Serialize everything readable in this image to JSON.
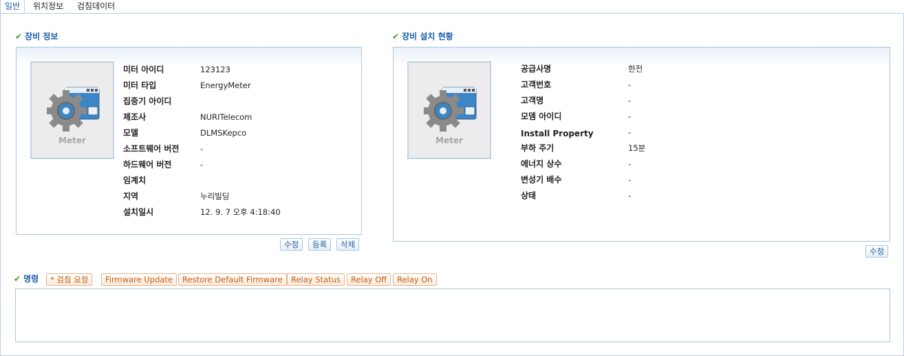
{
  "tabs": [
    "일반",
    "위치정보",
    "검침데이터"
  ],
  "device_info": {
    "title": "장비 정보",
    "thumb_label": "Meter",
    "rows": [
      {
        "label": "미터 아이디",
        "value": "123123"
      },
      {
        "label": "미터 타입",
        "value": "EnergyMeter"
      },
      {
        "label": "집중기 아이디",
        "value": ""
      },
      {
        "label": "제조사",
        "value": "NURITelecom"
      },
      {
        "label": "모델",
        "value": "DLMSKepco"
      },
      {
        "label": "소프트웨어 버전",
        "value": "-"
      },
      {
        "label": "하드웨어 버전",
        "value": "-"
      },
      {
        "label": "임계치",
        "value": ""
      },
      {
        "label": "지역",
        "value": "누리빌딩"
      },
      {
        "label": "설치일시",
        "value": "12. 9. 7 오후 4:18:40"
      }
    ],
    "buttons": [
      "수정",
      "등록",
      "삭제"
    ]
  },
  "install_status": {
    "title": "장비 설치 현황",
    "thumb_label": "Meter",
    "rows": [
      {
        "label": "공급사명",
        "value": "한전"
      },
      {
        "label": "고객번호",
        "value": "-"
      },
      {
        "label": "고객명",
        "value": "-"
      },
      {
        "label": "모뎀 아이디",
        "value": "-"
      },
      {
        "label": "Install Property",
        "value": "-"
      },
      {
        "label": "부하 주기",
        "value": "15분"
      },
      {
        "label": "에너지 상수",
        "value": "-"
      },
      {
        "label": "변성기 배수",
        "value": "-"
      },
      {
        "label": "상태",
        "value": "-"
      }
    ],
    "buttons": [
      "수정"
    ]
  },
  "commands": {
    "title": "명령",
    "buttons": [
      "* 검침 요청",
      "Firmware Update",
      "Restore Default Firmware",
      "Relay Status",
      "Relay Off",
      "Relay On"
    ]
  }
}
